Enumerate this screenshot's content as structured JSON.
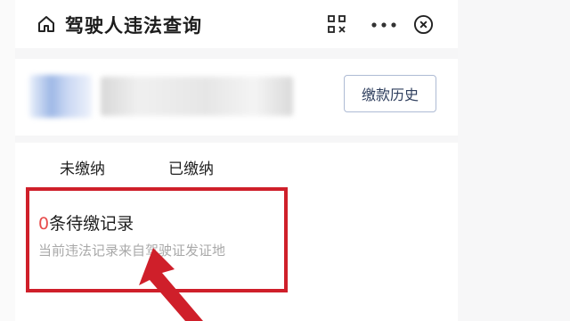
{
  "header": {
    "title": "驾驶人违法查询",
    "icons": [
      "home-icon",
      "qr-scan-icon",
      "more-icon",
      "close-icon"
    ]
  },
  "card": {
    "history_button": "缴款历史"
  },
  "tabs": [
    {
      "label": "未缴纳"
    },
    {
      "label": "已缴纳"
    }
  ],
  "record": {
    "count": "0",
    "count_label": "条待缴记录",
    "note": "当前违法记录来自驾驶证发证地"
  },
  "colors": {
    "highlight": "#cf1f2a",
    "count_number": "#e74c4c",
    "note_text": "#a9a9a9"
  }
}
